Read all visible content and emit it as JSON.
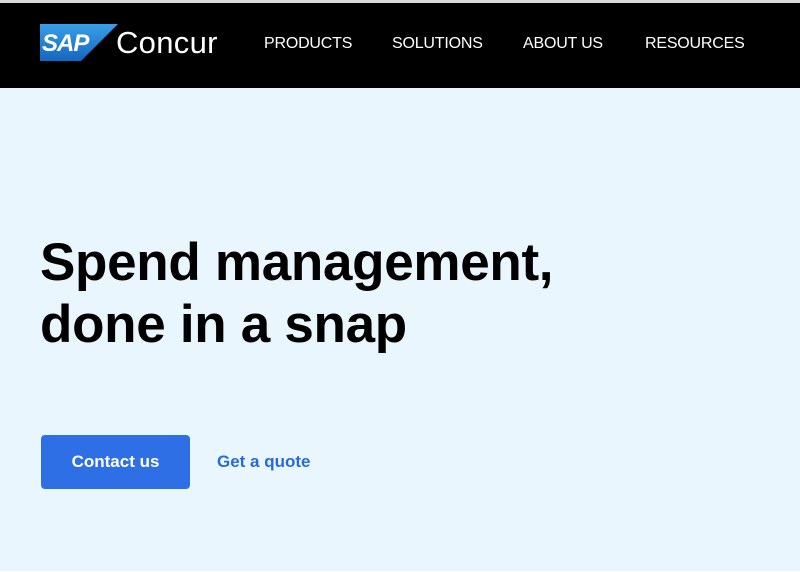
{
  "header": {
    "logo_badge": "SAP",
    "brand": "Concur",
    "nav": [
      {
        "label": "PRODUCTS"
      },
      {
        "label": "SOLUTIONS"
      },
      {
        "label": "ABOUT US"
      },
      {
        "label": "RESOURCES"
      }
    ]
  },
  "hero": {
    "title_line1": "Spend management,",
    "title_line2": "done in a snap",
    "primary_cta": "Contact us",
    "secondary_cta": "Get a quote"
  },
  "colors": {
    "header_bg": "#000000",
    "page_bg": "#eaf6fd",
    "primary": "#2f6fe6",
    "link": "#2a6ad8",
    "sap_blue": "#1a73c9"
  }
}
